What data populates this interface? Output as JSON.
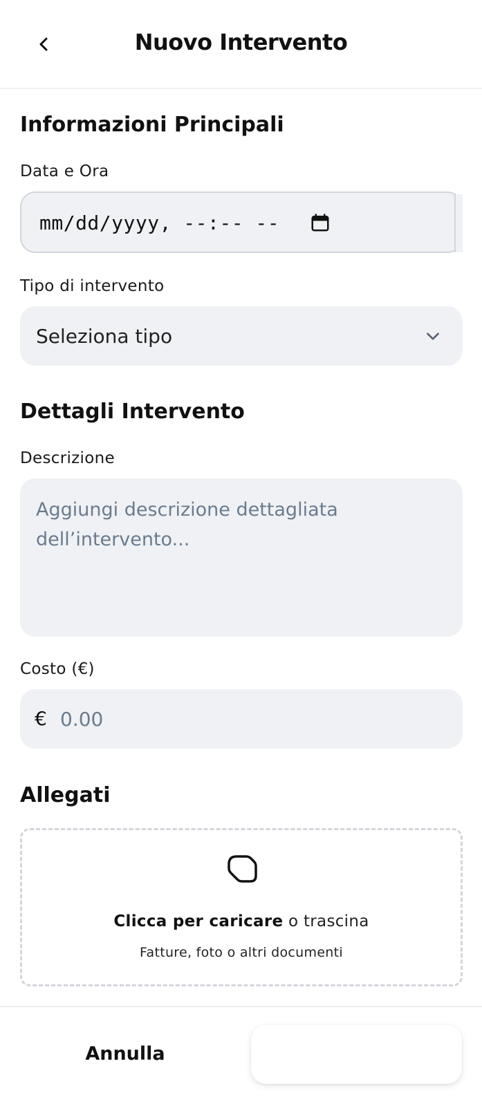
{
  "header": {
    "title": "Nuovo Intervento",
    "back_icon": "chevron-left-icon"
  },
  "main_info": {
    "section_title": "Informazioni Principali",
    "date_label": "Data e Ora",
    "date_value": "mm/dd/yyyy, --:-- --",
    "calendar_icon": "calendar-icon",
    "type_label": "Tipo di intervento",
    "type_selected": "Seleziona tipo",
    "type_chevron_icon": "chevron-down-icon"
  },
  "details": {
    "section_title": "Dettagli Intervento",
    "description_label": "Descrizione",
    "description_placeholder": "Aggiungi descrizione dettagliata dell’intervento...",
    "cost_label": "Costo (€)",
    "currency_symbol": "€",
    "cost_placeholder": "0.00"
  },
  "attachments": {
    "section_title": "Allegati",
    "upload_icon": "upload-icon",
    "upload_bold": "Clicca per caricare",
    "upload_rest": " o trascina",
    "upload_hint": "Fatture, foto o altri documenti"
  },
  "footer": {
    "cancel_label": "Annulla",
    "submit_label": ""
  },
  "colors": {
    "field_bg": "#eff1f4",
    "placeholder": "#6b7b8e",
    "border": "#d2d6dc",
    "text": "#111111"
  }
}
